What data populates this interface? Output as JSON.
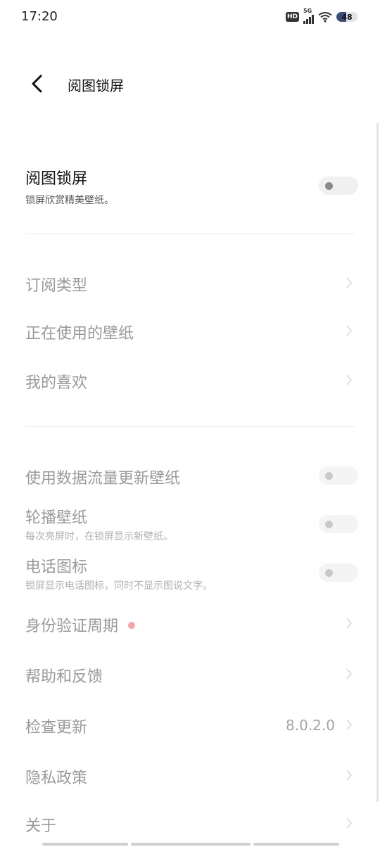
{
  "status_bar": {
    "time": "17:20",
    "hd": "HD",
    "network": "5G",
    "battery": "48",
    "battery_level": 0.48
  },
  "header": {
    "title": "阅图锁屏"
  },
  "settings": {
    "main_toggle": {
      "title": "阅图锁屏",
      "subtitle": "锁屏欣赏精美壁纸。",
      "on": false
    },
    "subscription": "订阅类型",
    "current_wallpaper": "正在使用的壁纸",
    "favorites": "我的喜欢",
    "mobile_data": {
      "title": "使用数据流量更新壁纸",
      "on": false
    },
    "carousel": {
      "title": "轮播壁纸",
      "subtitle": "每次亮屏时，在锁屏显示新壁纸。",
      "on": false
    },
    "phone_icon": {
      "title": "电话图标",
      "subtitle": "锁屏显示电话图标，同时不显示图说文字。",
      "on": false
    },
    "auth_period": "身份验证周期",
    "help": "帮助和反馈",
    "check_update": {
      "title": "检查更新",
      "version": "8.0.2.0"
    },
    "privacy": "隐私政策",
    "about": "关于"
  },
  "colors": {
    "text_dark": "#111111",
    "text_dim": "#9a9a9a",
    "dot": "#f5a3a3"
  }
}
